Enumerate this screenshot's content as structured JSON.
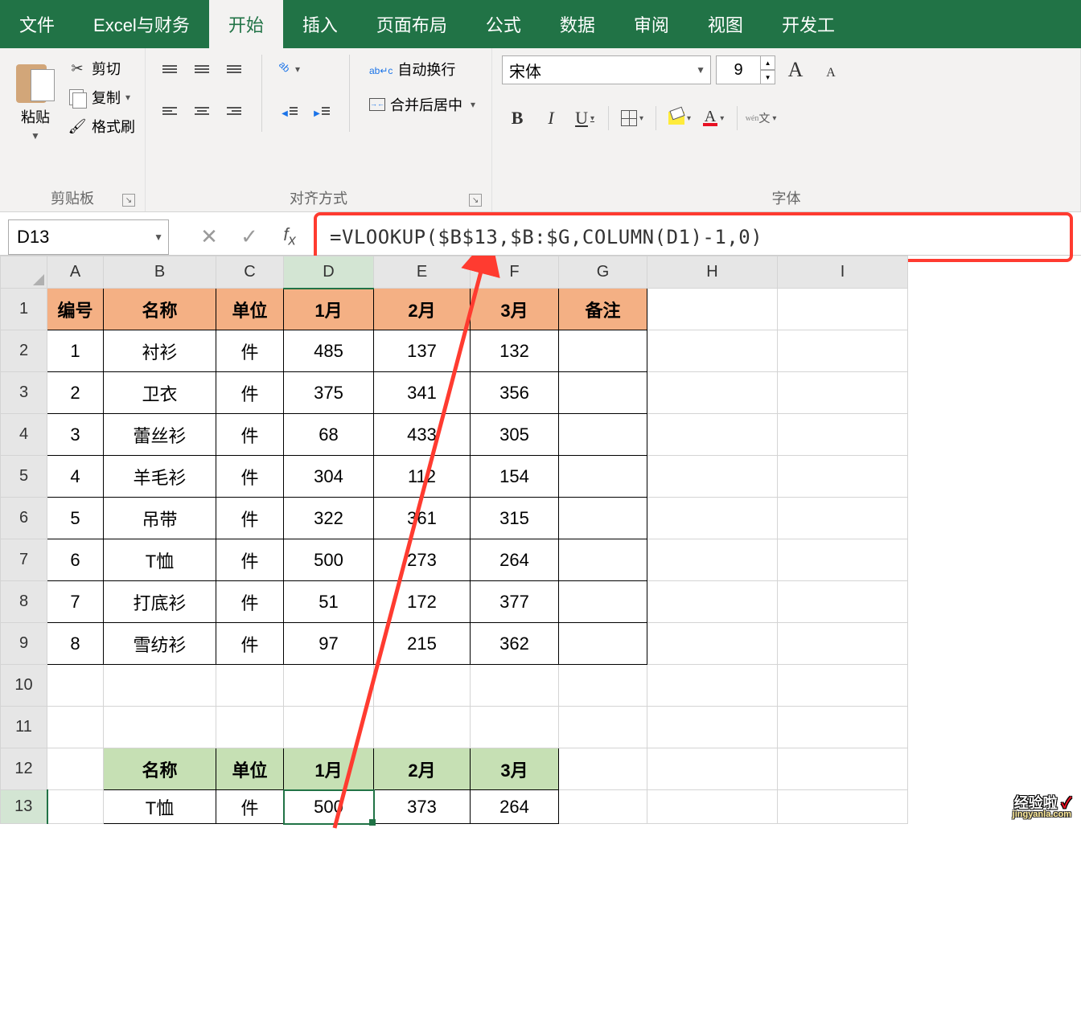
{
  "tabs": {
    "file": "文件",
    "custom": "Excel与财务",
    "home": "开始",
    "insert": "插入",
    "layout": "页面布局",
    "formulas": "公式",
    "data": "数据",
    "review": "审阅",
    "view": "视图",
    "developer": "开发工"
  },
  "ribbon": {
    "paste": "粘贴",
    "cut": "剪切",
    "copy": "复制",
    "formatPainter": "格式刷",
    "clipboard": "剪贴板",
    "wrapText": "自动换行",
    "mergeCenter": "合并后居中",
    "alignment": "对齐方式",
    "font": "字体",
    "fontName": "宋体",
    "fontSize": "9",
    "bold": "B",
    "italic": "I",
    "underline": "U",
    "pinyinTop": "wén",
    "pinyinBottom": "文"
  },
  "nameBox": "D13",
  "formula": "=VLOOKUP($B$13,$B:$G,COLUMN(D1)-1,0)",
  "columns": [
    "A",
    "B",
    "C",
    "D",
    "E",
    "F",
    "G",
    "H",
    "I"
  ],
  "rows": [
    "1",
    "2",
    "3",
    "4",
    "5",
    "6",
    "7",
    "8",
    "9",
    "10",
    "11",
    "12",
    "13"
  ],
  "header1": {
    "A": "编号",
    "B": "名称",
    "C": "单位",
    "D": "1月",
    "E": "2月",
    "F": "3月",
    "G": "备注"
  },
  "dataRows": [
    {
      "A": "1",
      "B": "衬衫",
      "C": "件",
      "D": "485",
      "E": "137",
      "F": "132"
    },
    {
      "A": "2",
      "B": "卫衣",
      "C": "件",
      "D": "375",
      "E": "341",
      "F": "356"
    },
    {
      "A": "3",
      "B": "蕾丝衫",
      "C": "件",
      "D": "68",
      "E": "433",
      "F": "305"
    },
    {
      "A": "4",
      "B": "羊毛衫",
      "C": "件",
      "D": "304",
      "E": "112",
      "F": "154"
    },
    {
      "A": "5",
      "B": "吊带",
      "C": "件",
      "D": "322",
      "E": "361",
      "F": "315"
    },
    {
      "A": "6",
      "B": "T恤",
      "C": "件",
      "D": "500",
      "E": "273",
      "F": "264"
    },
    {
      "A": "7",
      "B": "打底衫",
      "C": "件",
      "D": "51",
      "E": "172",
      "F": "377"
    },
    {
      "A": "8",
      "B": "雪纺衫",
      "C": "件",
      "D": "97",
      "E": "215",
      "F": "362"
    }
  ],
  "header2": {
    "B": "名称",
    "C": "单位",
    "D": "1月",
    "E": "2月",
    "F": "3月"
  },
  "resultRow": {
    "B": "T恤",
    "C": "件",
    "D": "500",
    "E": "373",
    "F": "264"
  },
  "watermark": {
    "text": "经验啦",
    "check": "✓",
    "sub": "jingyanla.com"
  }
}
